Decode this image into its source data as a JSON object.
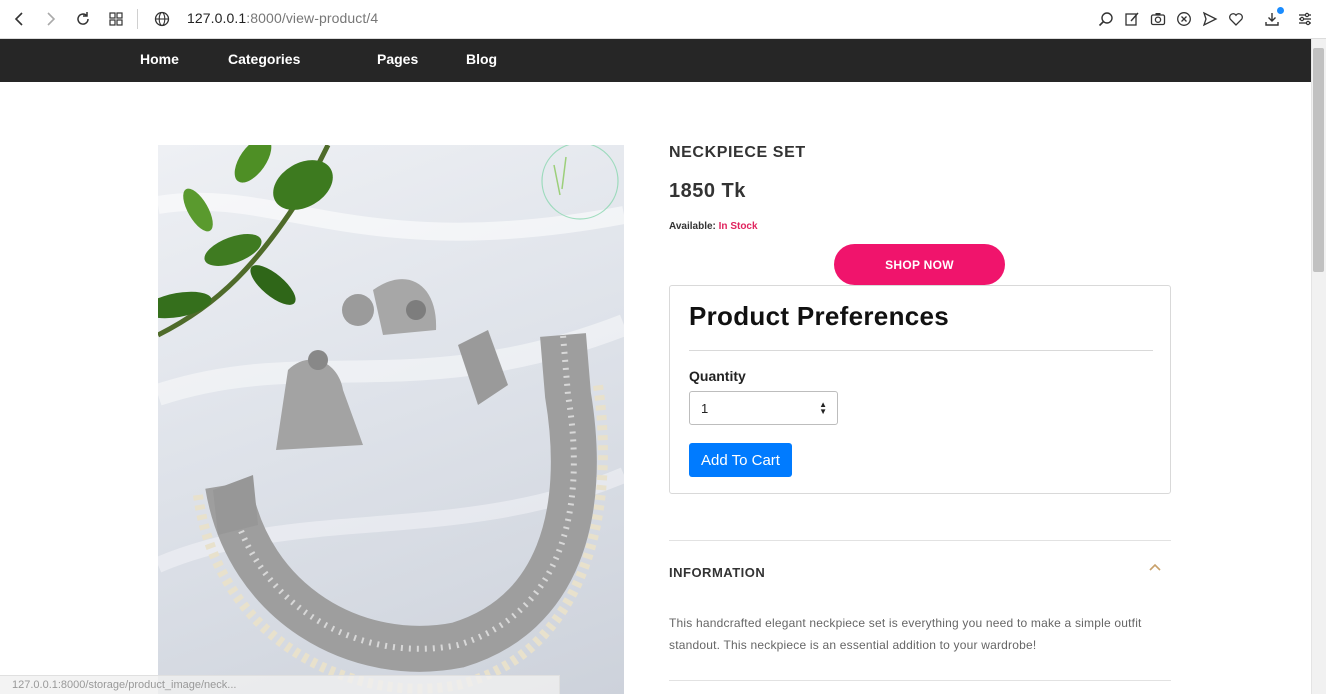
{
  "browser": {
    "url_host": "127.0.0.1",
    "url_path": ":8000/view-product/4",
    "status_url": "127.0.0.1:8000/storage/product_image/neck..."
  },
  "nav": {
    "items": [
      "Home",
      "Categories",
      "Pages",
      "Blog"
    ]
  },
  "product": {
    "title": "NECKPIECE SET",
    "price": "1850 Tk",
    "availability_label": "Available:",
    "availability_value": "In Stock",
    "shop_now": "SHOP NOW",
    "image_alt": "Neckpiece set with earrings on white fabric"
  },
  "preferences": {
    "heading": "Product Preferences",
    "quantity_label": "Quantity",
    "quantity_value": "1",
    "add_to_cart": "Add To Cart"
  },
  "information": {
    "heading": "INFORMATION",
    "text": "This handcrafted elegant neckpiece set is everything you need to make a simple outfit standout. This neckpiece is an essential addition to your wardrobe!"
  },
  "colors": {
    "nav_bg": "#262626",
    "shop_now": "#f0146c",
    "in_stock": "#e0245e",
    "add_to_cart": "#007bff"
  }
}
